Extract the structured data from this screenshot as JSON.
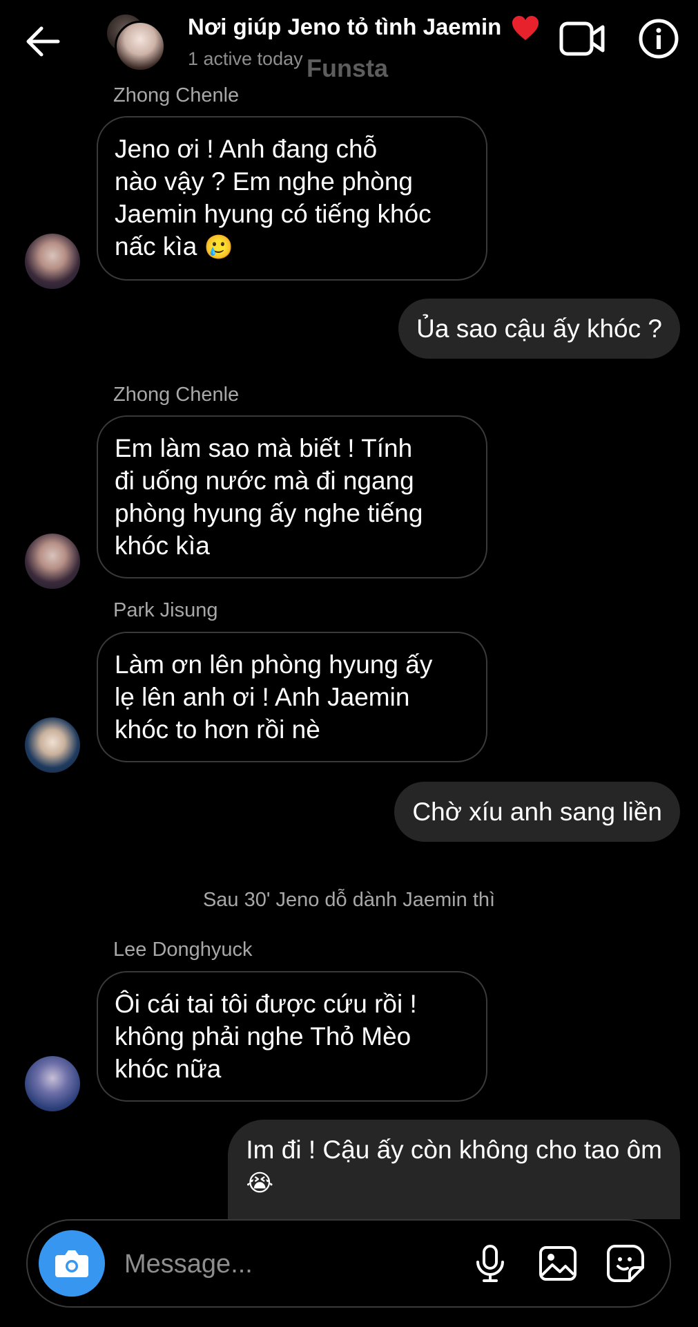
{
  "header": {
    "title": "Nơi giúp Jeno tỏ tình Jaemin",
    "status": "1 active today",
    "watermark": "Funsta"
  },
  "messages": [
    {
      "type": "incoming",
      "sender": "Zhong Chenle",
      "lines": [
        "Jeno ơi ! Anh đang chỗ",
        "nào vậy ? Em nghe phòng",
        "Jaemin hyung có tiếng khóc",
        "nấc kìa"
      ],
      "emoji": "🥲"
    },
    {
      "type": "outgoing",
      "text": "Ủa sao cậu ấy khóc ?"
    },
    {
      "type": "incoming",
      "sender": "Zhong Chenle",
      "lines": [
        "Em làm sao mà biết ! Tính",
        "đi uống nước mà đi ngang",
        "phòng hyung ấy nghe tiếng",
        "khóc kìa"
      ]
    },
    {
      "type": "incoming",
      "sender": "Park Jisung",
      "lines": [
        "Làm ơn lên phòng hyung ấy",
        "lẹ lên anh ơi ! Anh Jaemin",
        "khóc to hơn rồi nè"
      ]
    },
    {
      "type": "outgoing",
      "text": "Chờ xíu anh sang liền"
    },
    {
      "type": "system",
      "text": "Sau 30' Jeno dỗ dành Jaemin thì"
    },
    {
      "type": "incoming",
      "sender": "Lee Donghyuck",
      "lines": [
        "Ôi cái tai tôi được cứu rồi !",
        "không phải nghe Thỏ Mèo",
        "khóc nữa"
      ]
    },
    {
      "type": "outgoing",
      "lines": [
        "Im đi ! Cậu ấy còn không cho tao ôm"
      ],
      "emoji": "😭"
    }
  ],
  "composer": {
    "placeholder": "Message..."
  },
  "icons": {
    "back": "arrow-left-icon",
    "video": "video-camera-icon",
    "info": "info-icon",
    "camera": "camera-icon",
    "mic": "microphone-icon",
    "gallery": "image-icon",
    "sticker": "sticker-icon"
  },
  "colors": {
    "background": "#000000",
    "outgoing_bubble": "#262626",
    "camera_button": "#3797f0",
    "heart": "#e8222d"
  }
}
